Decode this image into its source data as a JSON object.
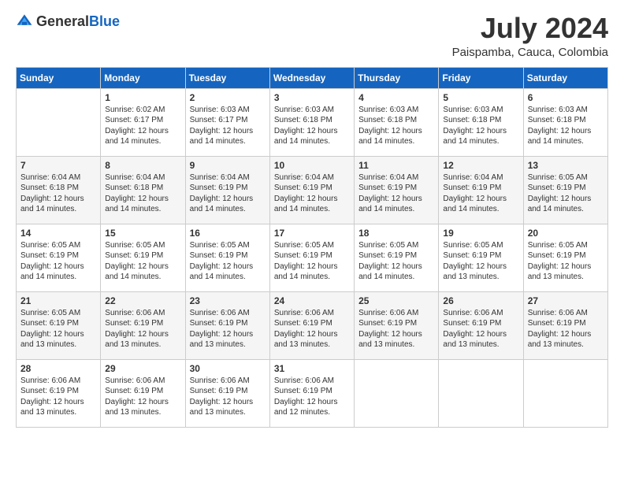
{
  "header": {
    "logo_general": "General",
    "logo_blue": "Blue",
    "month_title": "July 2024",
    "location": "Paispamba, Cauca, Colombia"
  },
  "days_of_week": [
    "Sunday",
    "Monday",
    "Tuesday",
    "Wednesday",
    "Thursday",
    "Friday",
    "Saturday"
  ],
  "weeks": [
    [
      {
        "day": "",
        "sunrise": "",
        "sunset": "",
        "daylight": ""
      },
      {
        "day": "1",
        "sunrise": "Sunrise: 6:02 AM",
        "sunset": "Sunset: 6:17 PM",
        "daylight": "Daylight: 12 hours and 14 minutes."
      },
      {
        "day": "2",
        "sunrise": "Sunrise: 6:03 AM",
        "sunset": "Sunset: 6:17 PM",
        "daylight": "Daylight: 12 hours and 14 minutes."
      },
      {
        "day": "3",
        "sunrise": "Sunrise: 6:03 AM",
        "sunset": "Sunset: 6:18 PM",
        "daylight": "Daylight: 12 hours and 14 minutes."
      },
      {
        "day": "4",
        "sunrise": "Sunrise: 6:03 AM",
        "sunset": "Sunset: 6:18 PM",
        "daylight": "Daylight: 12 hours and 14 minutes."
      },
      {
        "day": "5",
        "sunrise": "Sunrise: 6:03 AM",
        "sunset": "Sunset: 6:18 PM",
        "daylight": "Daylight: 12 hours and 14 minutes."
      },
      {
        "day": "6",
        "sunrise": "Sunrise: 6:03 AM",
        "sunset": "Sunset: 6:18 PM",
        "daylight": "Daylight: 12 hours and 14 minutes."
      }
    ],
    [
      {
        "day": "7",
        "sunrise": "Sunrise: 6:04 AM",
        "sunset": "Sunset: 6:18 PM",
        "daylight": "Daylight: 12 hours and 14 minutes."
      },
      {
        "day": "8",
        "sunrise": "Sunrise: 6:04 AM",
        "sunset": "Sunset: 6:18 PM",
        "daylight": "Daylight: 12 hours and 14 minutes."
      },
      {
        "day": "9",
        "sunrise": "Sunrise: 6:04 AM",
        "sunset": "Sunset: 6:19 PM",
        "daylight": "Daylight: 12 hours and 14 minutes."
      },
      {
        "day": "10",
        "sunrise": "Sunrise: 6:04 AM",
        "sunset": "Sunset: 6:19 PM",
        "daylight": "Daylight: 12 hours and 14 minutes."
      },
      {
        "day": "11",
        "sunrise": "Sunrise: 6:04 AM",
        "sunset": "Sunset: 6:19 PM",
        "daylight": "Daylight: 12 hours and 14 minutes."
      },
      {
        "day": "12",
        "sunrise": "Sunrise: 6:04 AM",
        "sunset": "Sunset: 6:19 PM",
        "daylight": "Daylight: 12 hours and 14 minutes."
      },
      {
        "day": "13",
        "sunrise": "Sunrise: 6:05 AM",
        "sunset": "Sunset: 6:19 PM",
        "daylight": "Daylight: 12 hours and 14 minutes."
      }
    ],
    [
      {
        "day": "14",
        "sunrise": "Sunrise: 6:05 AM",
        "sunset": "Sunset: 6:19 PM",
        "daylight": "Daylight: 12 hours and 14 minutes."
      },
      {
        "day": "15",
        "sunrise": "Sunrise: 6:05 AM",
        "sunset": "Sunset: 6:19 PM",
        "daylight": "Daylight: 12 hours and 14 minutes."
      },
      {
        "day": "16",
        "sunrise": "Sunrise: 6:05 AM",
        "sunset": "Sunset: 6:19 PM",
        "daylight": "Daylight: 12 hours and 14 minutes."
      },
      {
        "day": "17",
        "sunrise": "Sunrise: 6:05 AM",
        "sunset": "Sunset: 6:19 PM",
        "daylight": "Daylight: 12 hours and 14 minutes."
      },
      {
        "day": "18",
        "sunrise": "Sunrise: 6:05 AM",
        "sunset": "Sunset: 6:19 PM",
        "daylight": "Daylight: 12 hours and 14 minutes."
      },
      {
        "day": "19",
        "sunrise": "Sunrise: 6:05 AM",
        "sunset": "Sunset: 6:19 PM",
        "daylight": "Daylight: 12 hours and 13 minutes."
      },
      {
        "day": "20",
        "sunrise": "Sunrise: 6:05 AM",
        "sunset": "Sunset: 6:19 PM",
        "daylight": "Daylight: 12 hours and 13 minutes."
      }
    ],
    [
      {
        "day": "21",
        "sunrise": "Sunrise: 6:05 AM",
        "sunset": "Sunset: 6:19 PM",
        "daylight": "Daylight: 12 hours and 13 minutes."
      },
      {
        "day": "22",
        "sunrise": "Sunrise: 6:06 AM",
        "sunset": "Sunset: 6:19 PM",
        "daylight": "Daylight: 12 hours and 13 minutes."
      },
      {
        "day": "23",
        "sunrise": "Sunrise: 6:06 AM",
        "sunset": "Sunset: 6:19 PM",
        "daylight": "Daylight: 12 hours and 13 minutes."
      },
      {
        "day": "24",
        "sunrise": "Sunrise: 6:06 AM",
        "sunset": "Sunset: 6:19 PM",
        "daylight": "Daylight: 12 hours and 13 minutes."
      },
      {
        "day": "25",
        "sunrise": "Sunrise: 6:06 AM",
        "sunset": "Sunset: 6:19 PM",
        "daylight": "Daylight: 12 hours and 13 minutes."
      },
      {
        "day": "26",
        "sunrise": "Sunrise: 6:06 AM",
        "sunset": "Sunset: 6:19 PM",
        "daylight": "Daylight: 12 hours and 13 minutes."
      },
      {
        "day": "27",
        "sunrise": "Sunrise: 6:06 AM",
        "sunset": "Sunset: 6:19 PM",
        "daylight": "Daylight: 12 hours and 13 minutes."
      }
    ],
    [
      {
        "day": "28",
        "sunrise": "Sunrise: 6:06 AM",
        "sunset": "Sunset: 6:19 PM",
        "daylight": "Daylight: 12 hours and 13 minutes."
      },
      {
        "day": "29",
        "sunrise": "Sunrise: 6:06 AM",
        "sunset": "Sunset: 6:19 PM",
        "daylight": "Daylight: 12 hours and 13 minutes."
      },
      {
        "day": "30",
        "sunrise": "Sunrise: 6:06 AM",
        "sunset": "Sunset: 6:19 PM",
        "daylight": "Daylight: 12 hours and 13 minutes."
      },
      {
        "day": "31",
        "sunrise": "Sunrise: 6:06 AM",
        "sunset": "Sunset: 6:19 PM",
        "daylight": "Daylight: 12 hours and 12 minutes."
      },
      {
        "day": "",
        "sunrise": "",
        "sunset": "",
        "daylight": ""
      },
      {
        "day": "",
        "sunrise": "",
        "sunset": "",
        "daylight": ""
      },
      {
        "day": "",
        "sunrise": "",
        "sunset": "",
        "daylight": ""
      }
    ]
  ]
}
